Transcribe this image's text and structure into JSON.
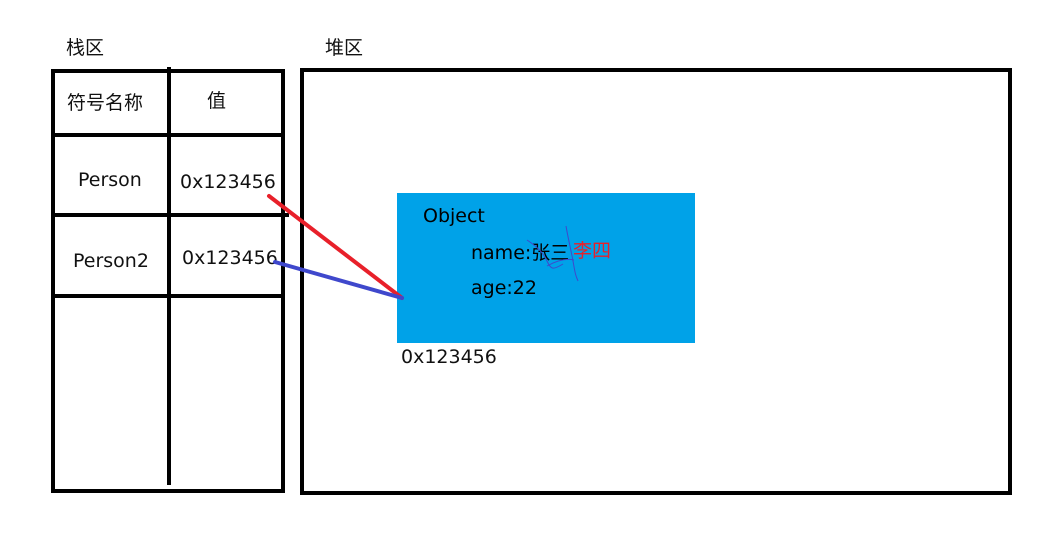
{
  "stack": {
    "title": "栈区",
    "headers": {
      "symbol": "符号名称",
      "value": "值"
    },
    "rows": [
      {
        "symbol": "Person",
        "value": "0x123456"
      },
      {
        "symbol": "Person2",
        "value": "0x123456"
      }
    ]
  },
  "heap": {
    "title": "堆区",
    "object": {
      "title": "Object",
      "name_label": "name:",
      "old_name": "张三",
      "new_name": "李四",
      "age": "age:22",
      "address": "0x123456"
    }
  },
  "colors": {
    "object_fill": "#00a2e8",
    "pointer_person": "#e8202a",
    "pointer_person2": "#3f48cc",
    "scribble": "#3f48cc",
    "new_name": "#e8202a"
  }
}
